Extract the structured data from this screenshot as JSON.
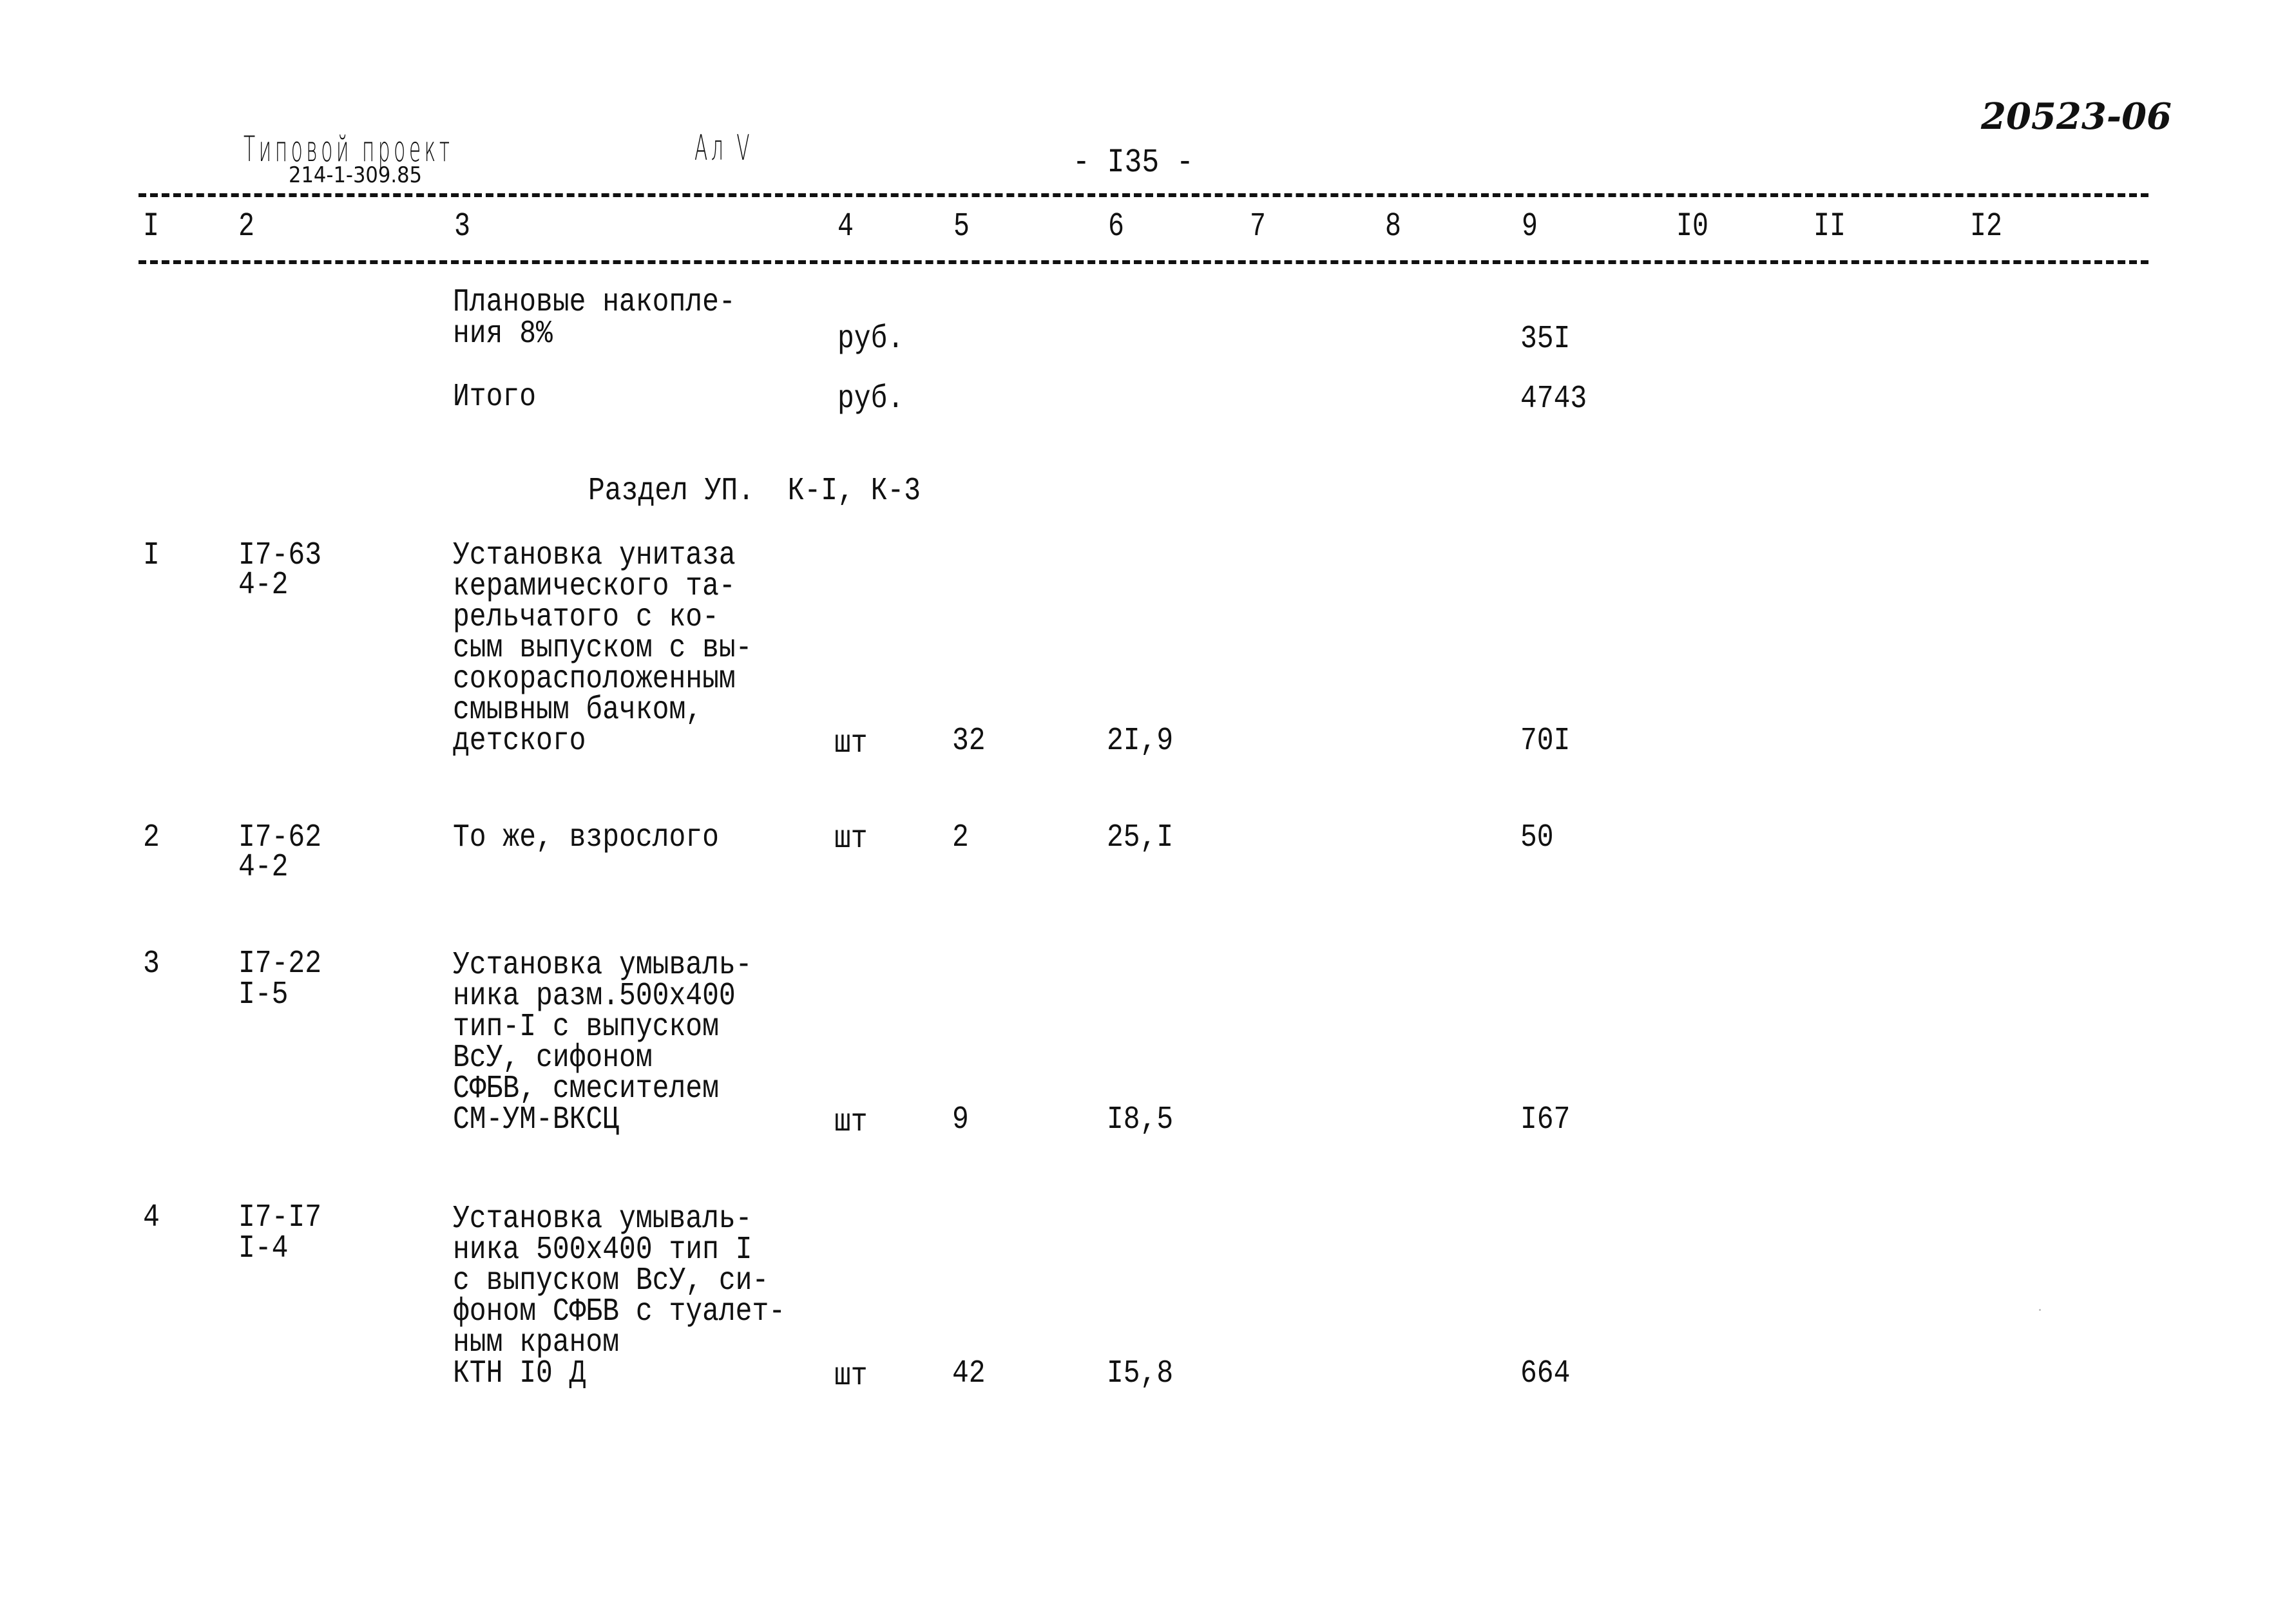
{
  "header": {
    "stamp_title": "Типовой проект",
    "stamp_code": "214-1-309.85",
    "album": "Ал V",
    "page_number": "- I35 -",
    "archive_number": "20523-06"
  },
  "columns": [
    "I",
    "2",
    "3",
    "4",
    "5",
    "6",
    "7",
    "8",
    "9",
    "I0",
    "II",
    "I2"
  ],
  "summary_rows": [
    {
      "name_lines": [
        "Плановые накопле-",
        "ния 8%"
      ],
      "unit": "руб.",
      "col9": "35I"
    },
    {
      "name_lines": [
        "Итого"
      ],
      "unit": "руб.",
      "col9": "4743"
    }
  ],
  "section_title": "Раздел УП.  К-I, К-3",
  "rows": [
    {
      "num": "I",
      "code_lines": [
        "I7-63",
        "4-2"
      ],
      "name_lines": [
        "Установка унитаза",
        "керамического та-",
        "рельчатого с ко-",
        "сым выпуском с вы-",
        "сокорасположенным",
        "смывным бачком,",
        "детского"
      ],
      "unit": "шт",
      "qty": "32",
      "price": "2I,9",
      "total": "70I"
    },
    {
      "num": "2",
      "code_lines": [
        "I7-62",
        "4-2"
      ],
      "name_lines": [
        "То же, взрослого"
      ],
      "unit": "шт",
      "qty": "2",
      "price": "25,I",
      "total": "50"
    },
    {
      "num": "3",
      "code_lines": [
        "I7-22",
        "I-5"
      ],
      "name_lines": [
        "Установка умываль-",
        "ника разм.500х400",
        "тип-I с выпуском",
        "ВсУ, сифоном",
        "СФБВ, смесителем",
        "СМ-УМ-ВКСЦ"
      ],
      "unit": "шт",
      "qty": "9",
      "price": "I8,5",
      "total": "I67"
    },
    {
      "num": "4",
      "code_lines": [
        "I7-I7",
        "I-4"
      ],
      "name_lines": [
        "Установка умываль-",
        "ника 500х400 тип I",
        "с выпуском ВсУ, си-",
        "фоном СФБВ с туалет-",
        "ным краном",
        "КТН I0 Д"
      ],
      "unit": "шт",
      "qty": "42",
      "price": "I5,8",
      "total": "664"
    }
  ]
}
